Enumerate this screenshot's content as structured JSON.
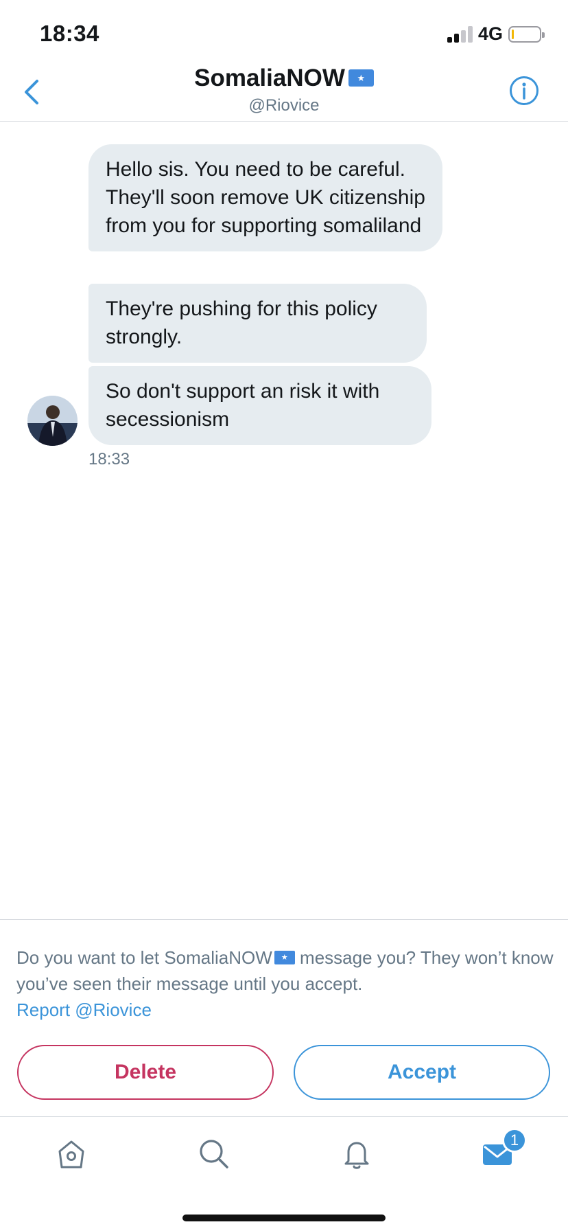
{
  "status_bar": {
    "time": "18:34",
    "network": "4G",
    "signal_bars_active": 2,
    "signal_bars_total": 4,
    "battery_level": 0.05
  },
  "header": {
    "title": "SomaliaNOW",
    "handle": "@Riovice",
    "back_icon": "chevron-left-icon",
    "info_icon": "info-icon",
    "flag_emoji": "somalia-flag"
  },
  "messages": [
    {
      "text": "Hello sis. You need to be careful. They'll soon remove UK citizenship from you for supporting somaliland"
    },
    {
      "text": "They're pushing for this policy strongly."
    },
    {
      "text": "So don't support an risk it with secessionism"
    }
  ],
  "message_time": "18:33",
  "request": {
    "prompt_before": "Do you want to let SomaliaNOW",
    "prompt_after": " message you? They won’t know you’ve seen their message until you accept.",
    "report_link": "Report @Riovice",
    "delete_label": "Delete",
    "accept_label": "Accept"
  },
  "tab_bar": {
    "icons": [
      "home-icon",
      "search-icon",
      "bell-icon",
      "mail-icon"
    ],
    "messages_badge": "1"
  },
  "colors": {
    "accent": "#3b94d9",
    "danger": "#c53460",
    "bubble": "#e6ecf0",
    "muted_text": "#657786"
  }
}
